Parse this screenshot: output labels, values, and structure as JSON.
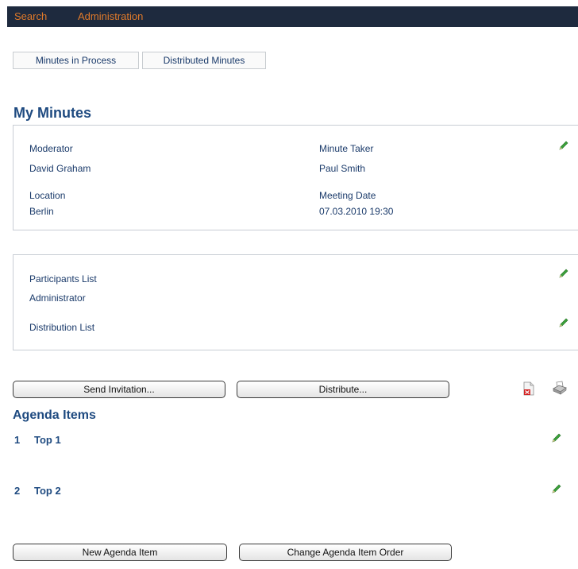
{
  "topnav": {
    "search": "Search",
    "administration": "Administration"
  },
  "tabs": [
    "Minutes in Process",
    "Distributed Minutes"
  ],
  "title": "My Minutes",
  "meeting": {
    "moderator_label": "Moderator",
    "moderator": "David Graham",
    "minute_taker_label": "Minute Taker",
    "minute_taker": "Paul Smith",
    "location_label": "Location",
    "location": "Berlin",
    "meeting_date_label": "Meeting Date",
    "meeting_date": "07.03.2010 19:30"
  },
  "lists": {
    "participants_label": "Participants List",
    "participants": [
      "Administrator"
    ],
    "distribution_label": "Distribution List"
  },
  "actions": {
    "send_invitation": "Send Invitation...",
    "distribute": "Distribute..."
  },
  "agenda": {
    "title": "Agenda Items",
    "items": [
      {
        "num": "1",
        "title": "Top 1"
      },
      {
        "num": "2",
        "title": "Top 2"
      }
    ],
    "new_item": "New Agenda Item",
    "change_order": "Change Agenda Item Order"
  },
  "icons": {
    "edit": "pencil-icon",
    "pdf": "pdf-export-icon",
    "print": "printer-icon"
  },
  "colors": {
    "accent": "#e07a2a",
    "topbar": "#1e2a3e",
    "heading": "#1e4a80",
    "text": "#1a3a6a"
  }
}
